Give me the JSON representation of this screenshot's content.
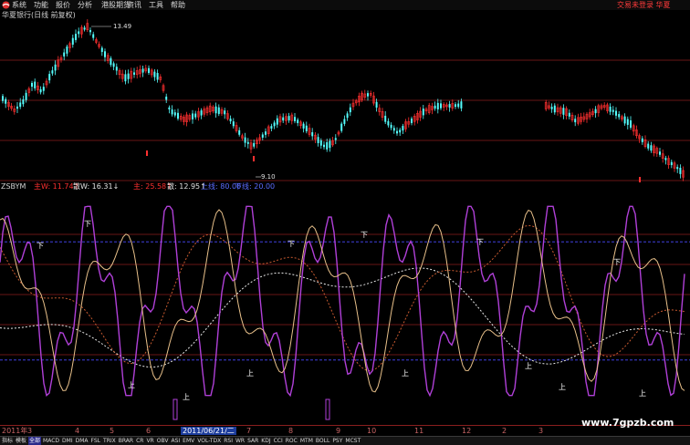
{
  "menu": {
    "items": [
      "系统",
      "功能",
      "报价",
      "分析",
      "港股期货",
      "资讯",
      "工具",
      "帮助"
    ],
    "right_text": "交易未登录 华夏"
  },
  "stock": {
    "title": "华夏银行(日线 前复权)"
  },
  "price_markers": {
    "high": "13.49",
    "low": "9.10"
  },
  "indicator": {
    "name": "ZSBYM",
    "params": [
      {
        "label": "主W:",
        "value": "11.74",
        "arrow": "↑",
        "color": "#ff3030"
      },
      {
        "label": "散W:",
        "value": "16.31",
        "arrow": "↓",
        "color": "#e0e0e0"
      },
      {
        "label": "主:",
        "value": "25.58",
        "arrow": "↑",
        "color": "#ff3030"
      },
      {
        "label": "散:",
        "value": "12.95",
        "arrow": "↑",
        "color": "#e0e0e0"
      },
      {
        "label": "上线:",
        "value": "80.00",
        "arrow": "",
        "color": "#5a6cff"
      },
      {
        "label": "下线:",
        "value": "20.00",
        "arrow": "",
        "color": "#5a6cff"
      }
    ],
    "marker_up": "上",
    "marker_down": "下"
  },
  "xaxis": {
    "labels": [
      "2011年",
      "3",
      "4",
      "5",
      "6",
      "7",
      "8",
      "9",
      "10",
      "11",
      "12",
      "2",
      "3"
    ],
    "cursor_date": "2011/06/21/二"
  },
  "tabs": {
    "items": [
      "指标",
      "模板",
      "全部",
      "MACD",
      "DMI",
      "DMA",
      "FSL",
      "TRIX",
      "BRAR",
      "CR",
      "VR",
      "OBV",
      "ASI",
      "EMV",
      "VOL-TDX",
      "RSI",
      "WR",
      "SAR",
      "KDJ",
      "CCI",
      "ROC",
      "MTM",
      "BOLL",
      "PSY",
      "MCST"
    ],
    "active_index": 2
  },
  "watermark": "www.7gpzb.com",
  "colors": {
    "up": "#ff3030",
    "down": "#54fcfc",
    "grid": "#8a1e1e",
    "reference": "#4a4aff",
    "zhu_w": "#e8c08a",
    "san_w": "#b040d8",
    "zhu": "#c85a30",
    "san": "#e8e8e8"
  },
  "chart_data": [
    {
      "type": "candlestick",
      "title": "华夏银行(日线 前复权)",
      "annotations": [
        "13.49",
        "9.10"
      ],
      "note": "daily candles; high 13.49, low 9.10"
    },
    {
      "type": "line",
      "title": "ZSBYM",
      "ylim": [
        0,
        100
      ],
      "reference_lines": [
        80,
        20
      ],
      "series": [
        {
          "name": "主W",
          "last": 11.74
        },
        {
          "name": "散W",
          "last": 16.31
        },
        {
          "name": "主",
          "last": 25.58
        },
        {
          "name": "散",
          "last": 12.95
        }
      ]
    }
  ]
}
